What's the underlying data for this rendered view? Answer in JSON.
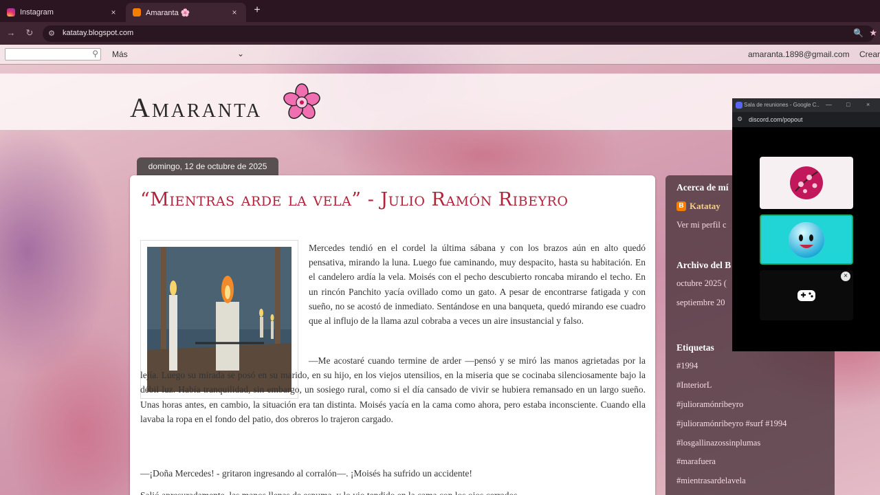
{
  "browser": {
    "tabs": [
      {
        "title": "Instagram",
        "active": false
      },
      {
        "title": "Amaranta 🌸",
        "active": true
      }
    ],
    "new_tab": "+",
    "close_glyph": "×",
    "url": "katatay.blogspot.com"
  },
  "blogger_bar": {
    "more": "Más",
    "email": "amaranta.1898@gmail.com",
    "create": "Crear"
  },
  "blog": {
    "title": "Amaranta"
  },
  "post": {
    "date": "domingo, 12 de octubre de 2025",
    "title": "“Mientras arde la vela” - Julio Ramón Ribeyro",
    "paragraphs": [
      "Mercedes tendió en el cordel la última sábana y con los brazos aún en alto quedó pensativa, mirando la luna. Luego fue caminando, muy despacito, hasta su habitación. En el candelero ardía la vela. Moisés con el pecho descubierto roncaba mirando el techo. En un rincón Panchito yacía ovillado como un gato. A pesar de encontrarse fatigada y con sueño, no se acostó de inmediato. Sentándose en una banqueta, quedó mirando ese cuadro que al influjo de la llama azul cobraba a veces un aire insustancial y falso.",
      "—Me acostaré cuando termine de arder —pensó y se miró las manos agrietadas por la lejía. Luego su mirada se posó en su marido, en su hijo, en los viejos utensilios, en la miseria que se cocinaba silenciosamente bajo la débil luz. Había tranquilidad, sin embargo, un sosiego rural, como si el día cansado de vivir se hubiera remansado en un largo sueño. Unas horas antes, en cambio, la situación era tan distinta. Moisés yacía en la cama como ahora, pero estaba inconsciente. Cuando ella lavaba la ropa en el fondo del patio, dos obreros lo trajeron cargado.",
      "—¡Doña Mercedes! - gritaron ingresando al corralón—. ¡Moisés ha sufrido un accidente!",
      "Salió apresuradamente, las manos llenas de espuma, y lo vio tendido en la cama con los ojos cerrados."
    ]
  },
  "sidebar": {
    "about_heading": "Acerca de mí",
    "author": "Katatay",
    "profile_link": "Ver mi perfil c",
    "archive_heading": "Archivo del B",
    "archive_items": [
      "octubre 2025 (",
      "septiembre 20"
    ],
    "labels_heading": "Etiquetas",
    "labels": [
      "#1994",
      "#InteriorL",
      "#julioramónribeyro",
      "#julioramónribeyro #surf #1994",
      "#losgallinazossinplumas",
      "#marafuera",
      "#mientrasardelavela"
    ]
  },
  "discord": {
    "window_title": "Sala de reuniones - Google C...",
    "url": "discord.com/popout",
    "close_glyph": "×"
  },
  "colors": {
    "post_title": "#b1233a",
    "discord_speaking": "#23a55a"
  }
}
